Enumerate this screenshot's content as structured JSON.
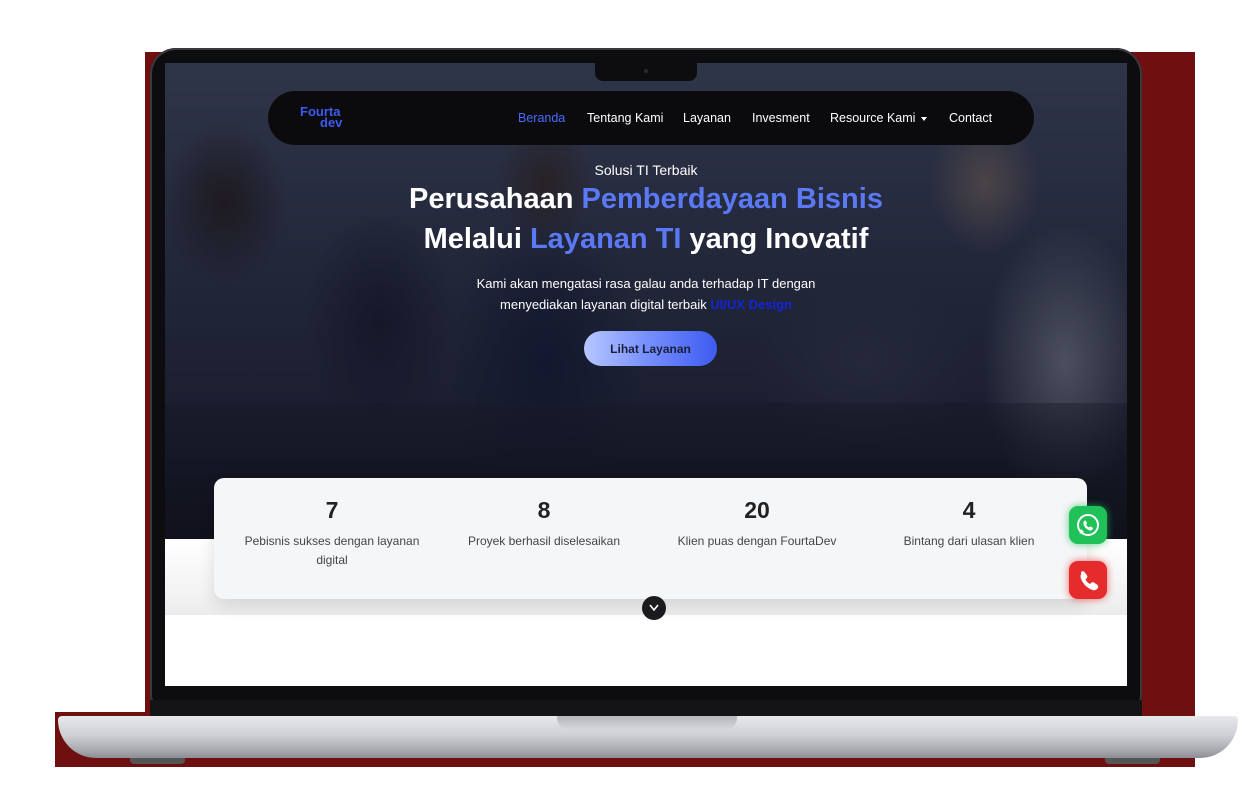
{
  "navbar": {
    "logo": {
      "line1": "Fourta",
      "line2": "dev"
    },
    "items": [
      {
        "label": "Beranda",
        "active": true
      },
      {
        "label": "Tentang Kami",
        "active": false
      },
      {
        "label": "Layanan",
        "active": false
      },
      {
        "label": "Invesment",
        "active": false
      },
      {
        "label": "Resource Kami",
        "active": false,
        "dropdown": true
      },
      {
        "label": "Contact",
        "active": false
      }
    ]
  },
  "hero": {
    "tagline": "Solusi TI Terbaik",
    "headline": {
      "line1_a": "Perusahaan ",
      "line1_b": "Pemberdayaan Bisnis",
      "line2_a": "Melalui ",
      "line2_b": "Layanan TI",
      "line2_c": " yang Inovatif"
    },
    "description": {
      "line1": "Kami akan mengatasi rasa galau anda terhadap IT dengan",
      "line2": "menyediakan layanan digital terbaik ",
      "highlight": "UI/UX Design"
    },
    "cta_label": "Lihat Layanan"
  },
  "stats": [
    {
      "value": "7",
      "label": "Pebisnis sukses dengan layanan digital"
    },
    {
      "value": "8",
      "label": "Proyek berhasil diselesaikan"
    },
    {
      "value": "20",
      "label": "Klien puas dengan FourtaDev"
    },
    {
      "value": "4",
      "label": "Bintang dari ulasan klien"
    }
  ],
  "icons": {
    "scroll": "chevron-down-icon",
    "whatsapp": "whatsapp-icon",
    "phone": "phone-icon"
  },
  "colors": {
    "accent": "#5b79f5",
    "whatsapp": "#1fc158",
    "phone": "#e52b2b",
    "backdrop": "#6e1010"
  }
}
